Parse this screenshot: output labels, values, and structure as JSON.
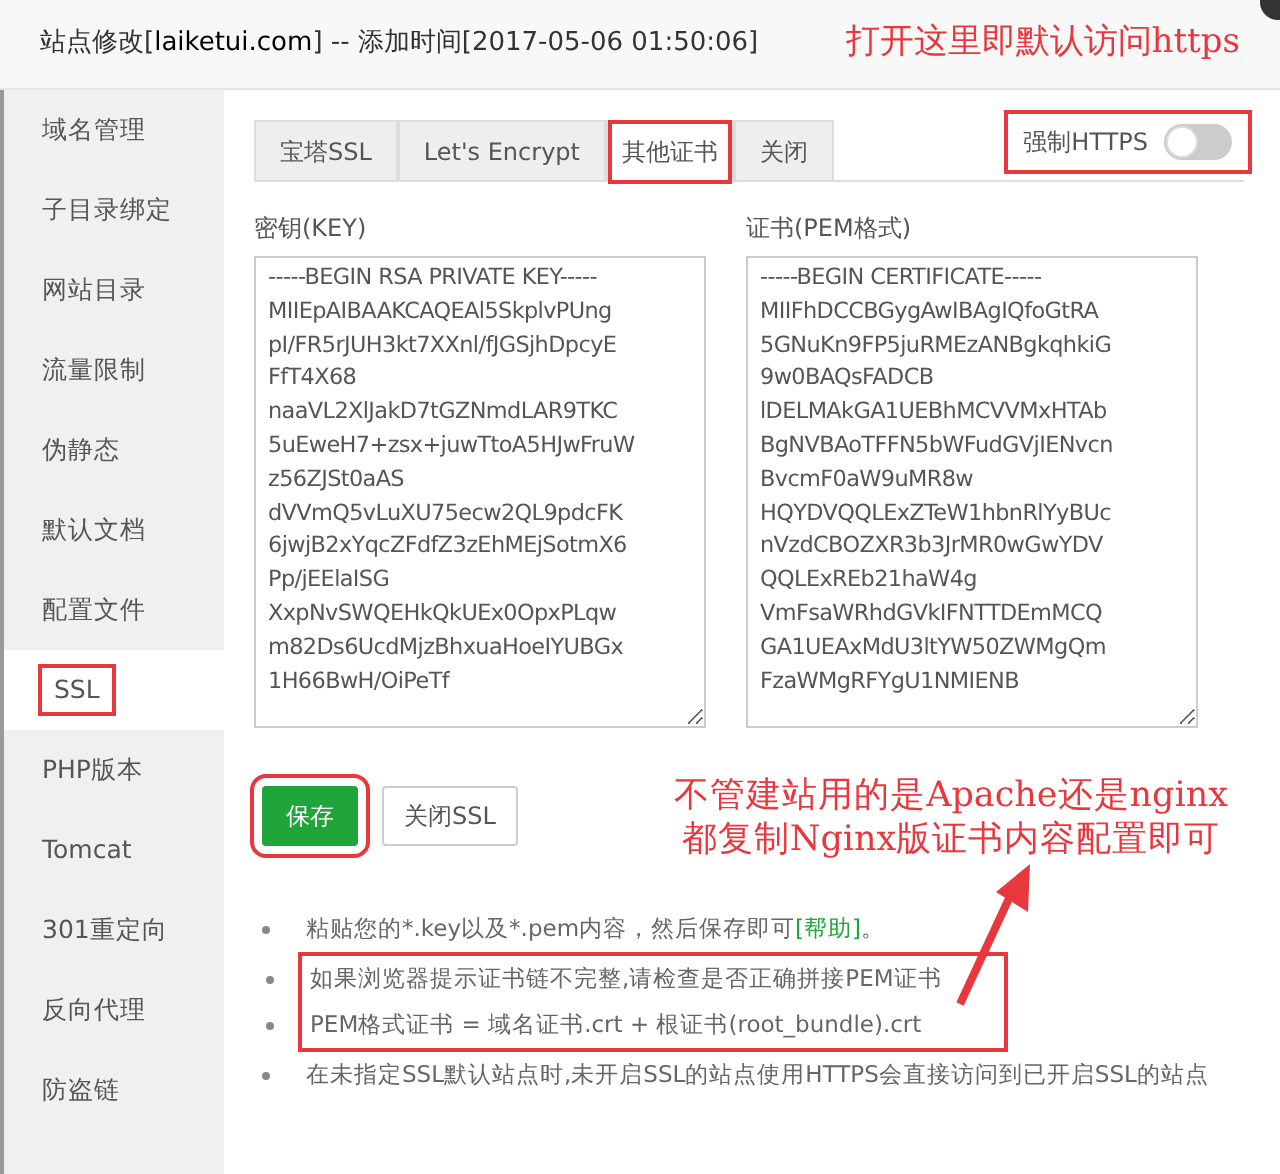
{
  "window": {
    "title_prefix": "站点修改[",
    "domain": "laiketui.com",
    "title_suffix": "] -- 添加时间[2017-05-06 01:50:06]"
  },
  "annotation_top": "打开这里即默认访问https",
  "sidebar": {
    "items": [
      {
        "label": "域名管理",
        "selected": false,
        "annotated": false
      },
      {
        "label": "子目录绑定",
        "selected": false,
        "annotated": false
      },
      {
        "label": "网站目录",
        "selected": false,
        "annotated": false
      },
      {
        "label": "流量限制",
        "selected": false,
        "annotated": false
      },
      {
        "label": "伪静态",
        "selected": false,
        "annotated": false
      },
      {
        "label": "默认文档",
        "selected": false,
        "annotated": false
      },
      {
        "label": "配置文件",
        "selected": false,
        "annotated": false
      },
      {
        "label": "SSL",
        "selected": true,
        "annotated": true
      },
      {
        "label": "PHP版本",
        "selected": false,
        "annotated": false
      },
      {
        "label": "Tomcat",
        "selected": false,
        "annotated": false
      },
      {
        "label": "301重定向",
        "selected": false,
        "annotated": false
      },
      {
        "label": "反向代理",
        "selected": false,
        "annotated": false
      },
      {
        "label": "防盗链",
        "selected": false,
        "annotated": false
      }
    ]
  },
  "tabs": [
    {
      "label": "宝塔SSL",
      "selected": false,
      "annotated": false
    },
    {
      "label": "Let's Encrypt",
      "selected": false,
      "annotated": false
    },
    {
      "label": "其他证书",
      "selected": true,
      "annotated": true
    },
    {
      "label": "关闭",
      "selected": false,
      "annotated": false
    }
  ],
  "force_https": {
    "label": "强制HTTPS",
    "on": false,
    "annotated": true
  },
  "key_field": {
    "label": "密钥(KEY)",
    "value": "-----BEGIN RSA PRIVATE KEY-----\nMIIEpAIBAAKCAQEAl5SkplvPUng\npI/FR5rJUH3kt7XXnl/fJGSjhDpcyE\nFfT4X68\nnaaVL2XlJakD7tGZNmdLAR9TKC\n5uEweH7+zsx+juwTtoA5HJwFruW\nz56ZJSt0aAS\ndVVmQ5vLuXU75ecw2QL9pdcFK\n6jwjB2xYqcZFdfZ3zEhMEjSotmX6\nPp/jEElaISG\nXxpNvSWQEHkQkUEx0OpxPLqw\nm82Ds6UcdMjzBhxuaHoeIYUBGx\n1H66BwH/OiPeTf"
  },
  "cert_field": {
    "label": "证书(PEM格式)",
    "value": "-----BEGIN CERTIFICATE-----\nMIIFhDCCBGygAwIBAgIQfoGtRA\n5GNuKn9FP5juRMEzANBgkqhkiG\n9w0BAQsFADCB\nlDELMAkGA1UEBhMCVVMxHTAb\nBgNVBAoTFFN5bWFudGVjIENvcn\nBvcmF0aW9uMR8w\nHQYDVQQLExZTeW1hbnRlYyBUc\nnVzdCBOZXR3b3JrMR0wGwYDV\nQQLExREb21haW4g\nVmFsaWRhdGVkIFNTTDEmMCQ\nGA1UEAxMdU3ltYW50ZWMgQm\nFzaWMgRFYgU1NMIENB"
  },
  "buttons": [
    {
      "label": "保存",
      "kind": "primary",
      "annotated": true
    },
    {
      "label": "关闭SSL",
      "kind": "default"
    }
  ],
  "annotation_middle": [
    "不管建站用的是Apache还是nginx",
    "都复制Nginx版证书内容配置即可"
  ],
  "notes": [
    {
      "text": "粘贴您的*.key以及*.pem内容，然后保存即可",
      "link": "[帮助]",
      "after": "。",
      "annotated": false
    },
    {
      "text": "如果浏览器提示证书链不完整,请检查是否正确拼接PEM证书",
      "annotated": true
    },
    {
      "text": "PEM格式证书 = 域名证书.crt + 根证书(root_bundle).crt",
      "annotated": true
    },
    {
      "text": "在未指定SSL默认站点时,未开启SSL的站点使用HTTPS会直接访问到已开启SSL的站点",
      "annotated": false
    }
  ]
}
